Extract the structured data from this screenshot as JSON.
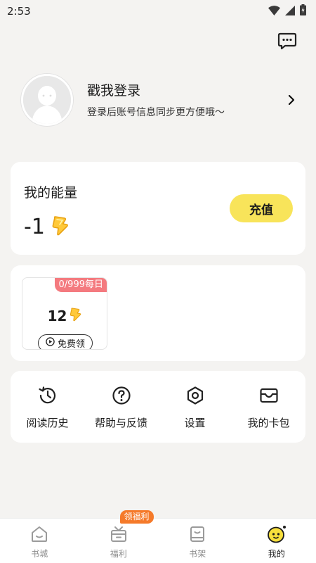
{
  "status_bar": {
    "time": "2:53"
  },
  "profile": {
    "title": "戳我登录",
    "subtitle": "登录后账号信息同步更方便哦～"
  },
  "energy": {
    "label": "我的能量",
    "value": "-1",
    "recharge_label": "充值"
  },
  "task": {
    "badge": "0/999每日",
    "value": "12",
    "free_label": "免费领"
  },
  "menu": {
    "items": [
      {
        "label": "阅读历史",
        "icon": "history-icon"
      },
      {
        "label": "帮助与反馈",
        "icon": "help-icon"
      },
      {
        "label": "设置",
        "icon": "settings-icon"
      },
      {
        "label": "我的卡包",
        "icon": "card-wallet-icon"
      }
    ]
  },
  "tabbar": {
    "items": [
      {
        "label": "书城",
        "icon": "home-icon",
        "active": false
      },
      {
        "label": "福利",
        "icon": "gift-icon",
        "active": false,
        "badge": "领福利"
      },
      {
        "label": "书架",
        "icon": "bookshelf-icon",
        "active": false
      },
      {
        "label": "我的",
        "icon": "mascot-icon",
        "active": true
      }
    ]
  },
  "colors": {
    "accent_yellow": "#f8e45a",
    "badge_pink": "#f47a7f",
    "badge_orange": "#f57a2a",
    "background": "#f4f3f1"
  }
}
